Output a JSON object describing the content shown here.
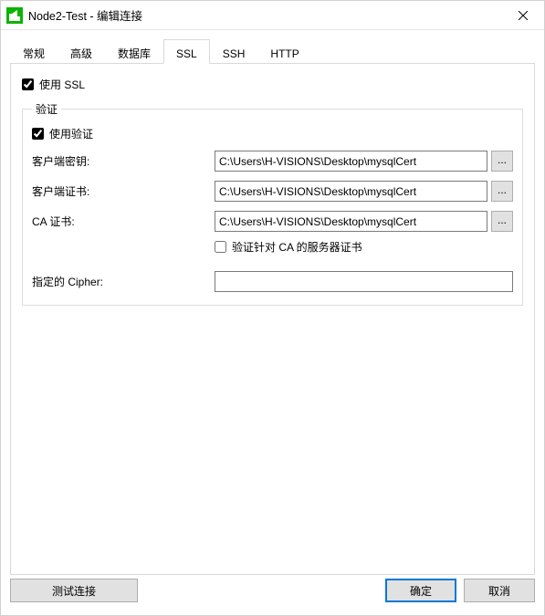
{
  "window": {
    "title": "Node2-Test - 编辑连接"
  },
  "tabs": {
    "general": "常规",
    "advanced": "高级",
    "database": "数据库",
    "ssl": "SSL",
    "ssh": "SSH",
    "http": "HTTP"
  },
  "ssl": {
    "use_ssl_label": "使用 SSL",
    "use_ssl_checked": true,
    "verify_group_label": "验证",
    "use_verify_label": "使用验证",
    "use_verify_checked": true,
    "client_key_label": "客户端密钥:",
    "client_key_value": "C:\\Users\\H-VISIONS\\Desktop\\mysqlCert",
    "client_cert_label": "客户端证书:",
    "client_cert_value": "C:\\Users\\H-VISIONS\\Desktop\\mysqlCert",
    "ca_cert_label": "CA 证书:",
    "ca_cert_value": "C:\\Users\\H-VISIONS\\Desktop\\mysqlCert",
    "verify_server_label": "验证针对 CA 的服务器证书",
    "verify_server_checked": false,
    "cipher_label": "指定的 Cipher:",
    "cipher_value": ""
  },
  "footer": {
    "test_label": "测试连接",
    "ok_label": "确定",
    "cancel_label": "取消"
  },
  "browse_label": "..."
}
